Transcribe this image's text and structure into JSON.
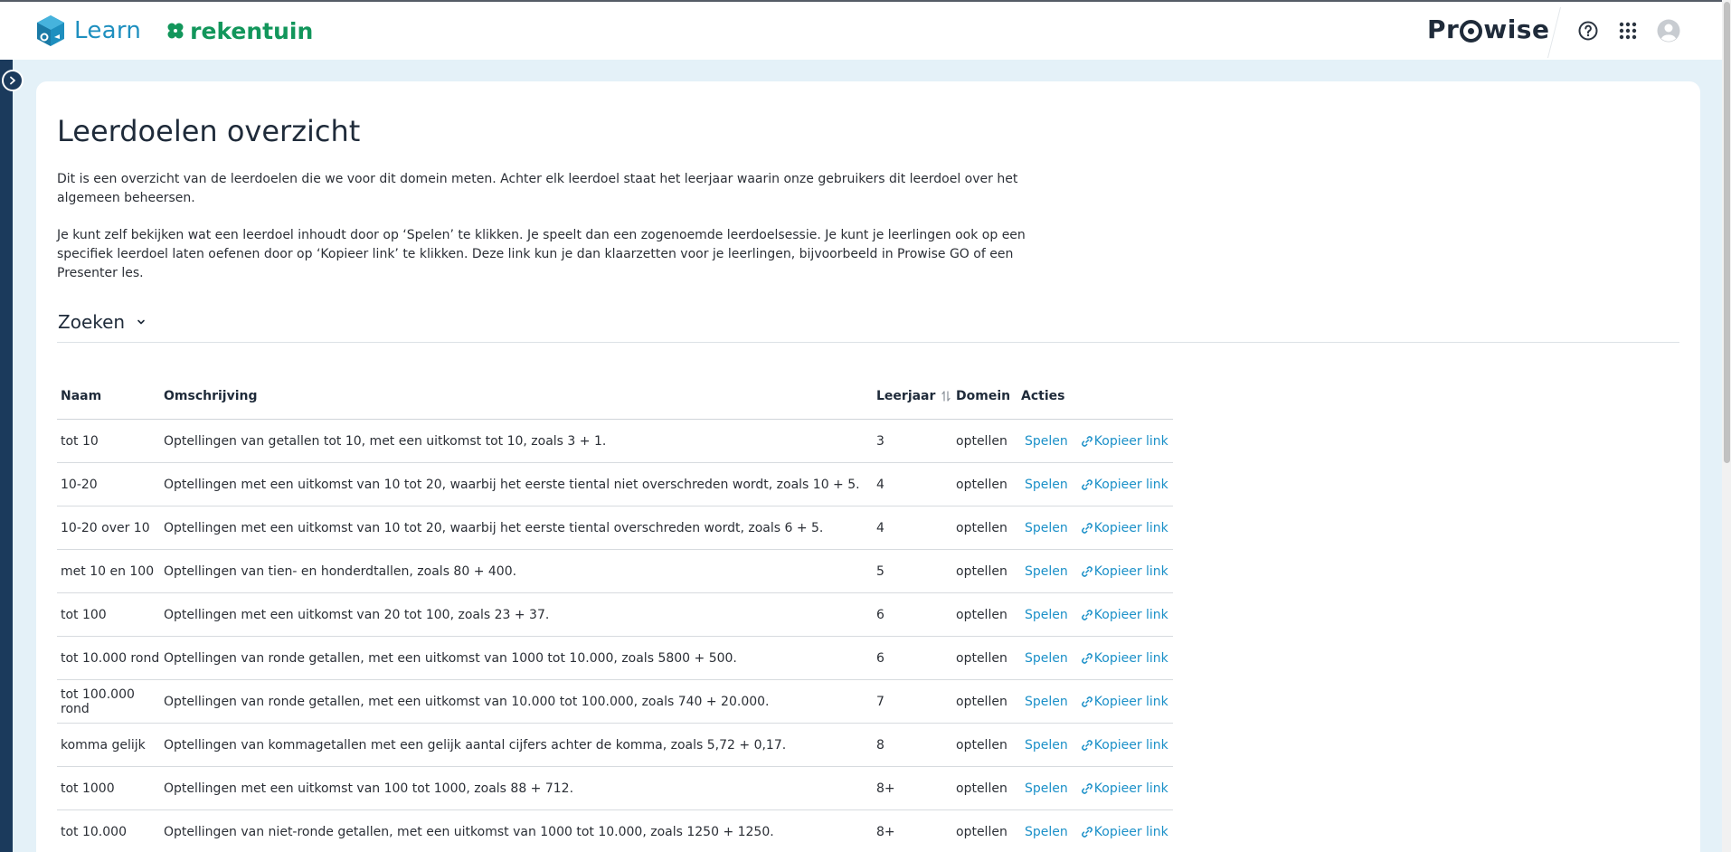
{
  "header": {
    "learn_label": "Learn",
    "rekentuin_label": "rekentuin",
    "prowise_label_pre": "Pr",
    "prowise_label_post": "wise",
    "icons": [
      "learn-cube-icon",
      "rekentuin-icon",
      "help-icon",
      "apps-grid-icon",
      "user-avatar-icon"
    ]
  },
  "page": {
    "title": "Leerdoelen overzicht",
    "intro_1": "Dit is een overzicht van de leerdoelen die we voor dit domein meten. Achter elk leerdoel staat het leerjaar waarin onze gebruikers dit leerdoel over het algemeen beheersen.",
    "intro_2": "Je kunt zelf bekijken wat een leerdoel inhoudt door op ‘Spelen’ te klikken. Je speelt dan een zogenoemde leerdoelsessie. Je kunt je leerlingen ook op een specifiek leerdoel laten oefenen door op ‘Kopieer link’ te klikken. Deze link kun je dan klaarzetten voor je leerlingen, bijvoorbeeld in Prowise GO of een Presenter les.",
    "search_label": "Zoeken"
  },
  "table": {
    "headers": {
      "naam": "Naam",
      "omschrijving": "Omschrijving",
      "leerjaar": "Leerjaar",
      "domein": "Domein",
      "acties": "Acties"
    },
    "action_play": "Spelen",
    "action_copy": "Kopieer link",
    "rows": [
      {
        "naam": "tot 10",
        "omschrijving": "Optellingen van getallen tot 10, met een uitkomst tot 10, zoals 3 + 1.",
        "leerjaar": "3",
        "domein": "optellen"
      },
      {
        "naam": "10-20",
        "omschrijving": "Optellingen met een uitkomst van 10 tot 20, waarbij het eerste tiental niet overschreden wordt, zoals 10 + 5.",
        "leerjaar": "4",
        "domein": "optellen"
      },
      {
        "naam": "10-20 over 10",
        "omschrijving": "Optellingen met een uitkomst van 10 tot 20, waarbij het eerste tiental overschreden wordt, zoals 6 + 5.",
        "leerjaar": "4",
        "domein": "optellen"
      },
      {
        "naam": "met 10 en 100",
        "omschrijving": "Optellingen van tien- en honderdtallen, zoals 80 + 400.",
        "leerjaar": "5",
        "domein": "optellen"
      },
      {
        "naam": "tot 100",
        "omschrijving": "Optellingen met een uitkomst van 20 tot 100, zoals 23 + 37.",
        "leerjaar": "6",
        "domein": "optellen"
      },
      {
        "naam": "tot 10.000 rond",
        "omschrijving": "Optellingen van ronde getallen, met een uitkomst van 1000 tot 10.000, zoals 5800 + 500.",
        "leerjaar": "6",
        "domein": "optellen"
      },
      {
        "naam": "tot 100.000 rond",
        "omschrijving": "Optellingen van ronde getallen, met een uitkomst van 10.000 tot 100.000, zoals 740 + 20.000.",
        "leerjaar": "7",
        "domein": "optellen"
      },
      {
        "naam": "komma gelijk",
        "omschrijving": "Optellingen van kommagetallen met een gelijk aantal cijfers achter de komma, zoals 5,72 + 0,17.",
        "leerjaar": "8",
        "domein": "optellen"
      },
      {
        "naam": "tot 1000",
        "omschrijving": "Optellingen met een uitkomst van 100 tot 1000, zoals 88 + 712.",
        "leerjaar": "8+",
        "domein": "optellen"
      },
      {
        "naam": "tot 10.000",
        "omschrijving": "Optellingen van niet-ronde getallen, met een uitkomst van 1000 tot 10.000, zoals 1250 + 1250.",
        "leerjaar": "8+",
        "domein": "optellen"
      }
    ]
  },
  "colors": {
    "brand_blue": "#1e8fbf",
    "brand_green": "#12965b",
    "link": "#1b90c8",
    "navy": "#1b3a5c",
    "page_bg": "#e4f1f8"
  }
}
